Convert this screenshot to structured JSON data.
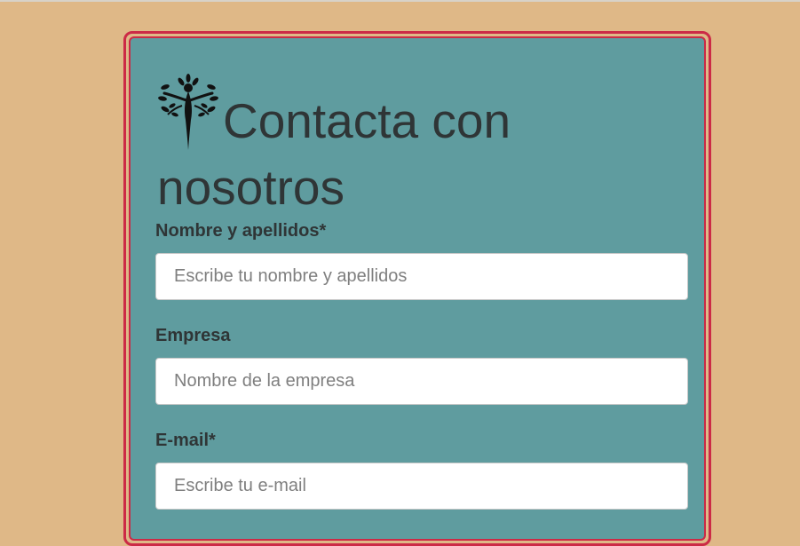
{
  "form": {
    "title": "Contacta con nosotros",
    "logo_icon": "tree-figure-logo-icon",
    "fields": [
      {
        "label": "Nombre y apellidos*",
        "placeholder": "Escribe tu nombre y apellidos",
        "value": ""
      },
      {
        "label": "Empresa",
        "placeholder": "Nombre de la empresa",
        "value": ""
      },
      {
        "label": "E-mail*",
        "placeholder": "Escribe tu e-mail",
        "value": ""
      }
    ]
  },
  "colors": {
    "page_background": "#dfb887",
    "card_background": "#5f9c9f",
    "card_border": "#cc2a46",
    "text": "#2f3536"
  }
}
